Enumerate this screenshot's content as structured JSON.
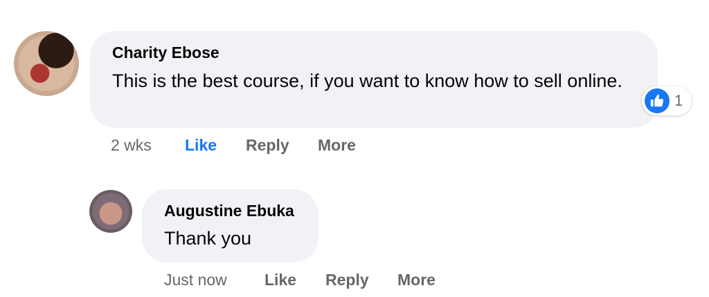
{
  "comments": [
    {
      "author": "Charity Ebose",
      "text": "This is the best course, if you want to know how to sell online.",
      "time": "2 wks",
      "actions": {
        "like": "Like",
        "reply": "Reply",
        "more": "More"
      },
      "reaction_count": "1",
      "reaction_icon": "thumbs-up-icon"
    },
    {
      "author": "Augustine Ebuka",
      "text": "Thank you",
      "time": "Just now",
      "actions": {
        "like": "Like",
        "reply": "Reply",
        "more": "More"
      }
    }
  ],
  "colors": {
    "bubble": "#f0f2f5",
    "like_active": "#1877f2",
    "secondary_text": "#65676b"
  }
}
